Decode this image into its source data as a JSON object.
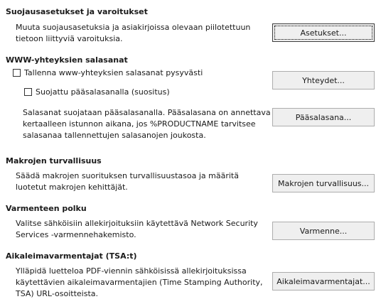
{
  "security_options": {
    "heading": "Suojausasetukset ja varoitukset",
    "desc_lines": [
      "Muuta suojausasetuksia ja asiakirjoissa olevaan piilotettuun",
      "tietoon liittyviä varoituksia."
    ],
    "button_label": "Asetukset..."
  },
  "web_passwords": {
    "heading": "WWW-yhteyksien salasanat",
    "persist_checkbox_label": "Tallenna www-yhteyksien salasanat pysyvästi",
    "master_checkbox_label": "Suojattu pääsalasanalla (suositus)",
    "connections_button_label": "Yhteydet...",
    "desc_lines": [
      "Salasanat suojataan pääsalasanalla. Pääsalasana on annettava",
      "kertaalleen istunnon aikana, jos %PRODUCTNAME tarvitsee",
      "salasanaa tallennettujen salasanojen joukosta."
    ],
    "master_button_label": "Pääsalasana..."
  },
  "macro_security": {
    "heading": "Makrojen turvallisuus",
    "desc_lines": [
      "Säädä makrojen suorituksen turvallisuustasoa ja määritä",
      "luotetut makrojen kehittäjät."
    ],
    "button_label": "Makrojen turvallisuus..."
  },
  "certificate_path": {
    "heading": "Varmenteen polku",
    "desc_lines": [
      "Valitse sähköisiin allekirjoituksiin käytettävä Network Security",
      "Services -varmennehakemisto."
    ],
    "button_label": "Varmenne..."
  },
  "tsa": {
    "heading": "Aikaleimavarmentajat (TSA:t)",
    "desc_lines": [
      "Ylläpidä luetteloa PDF-viennin sähköisissä allekirjoituksissa",
      "käytettävien aikaleimavarmentajien (Time Stamping Authority,",
      "TSA) URL-osoitteista."
    ],
    "button_label": "Aikaleimavarmentajat..."
  }
}
